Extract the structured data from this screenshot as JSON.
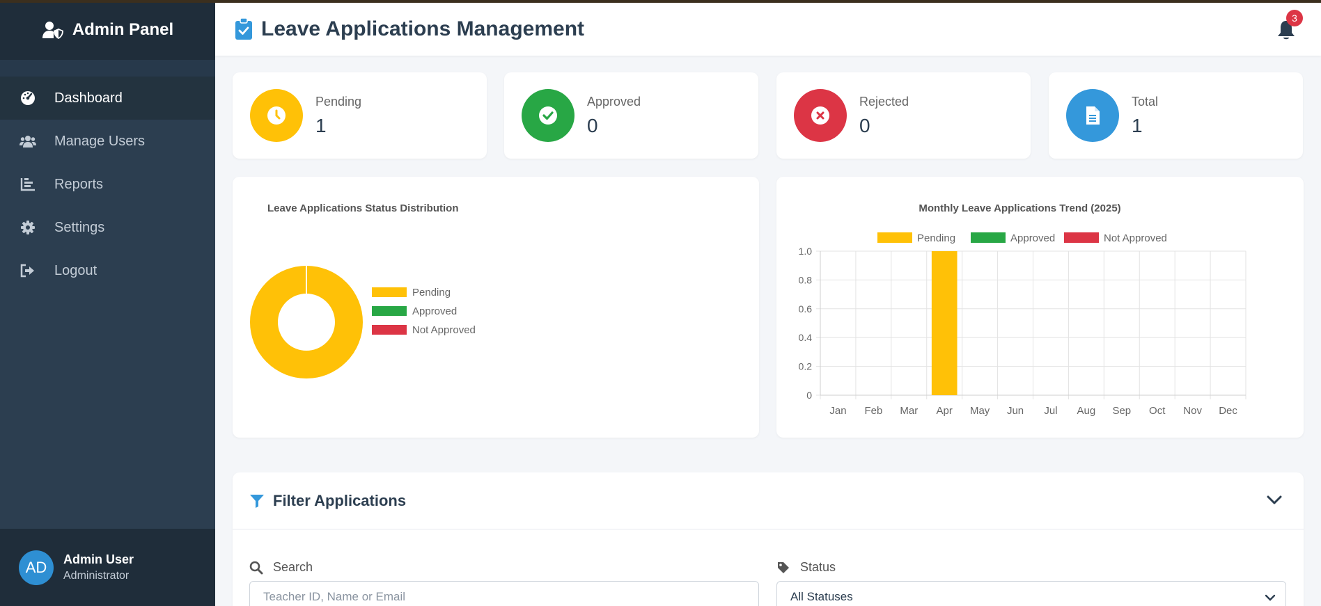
{
  "sidebar": {
    "brand": "Admin Panel",
    "items": [
      {
        "label": "Dashboard",
        "icon": "gauge-icon",
        "active": true
      },
      {
        "label": "Manage Users",
        "icon": "users-icon"
      },
      {
        "label": "Reports",
        "icon": "chart-bar-icon"
      },
      {
        "label": "Settings",
        "icon": "gear-icon"
      },
      {
        "label": "Logout",
        "icon": "logout-icon"
      }
    ],
    "user": {
      "initials": "AD",
      "name": "Admin User",
      "role": "Administrator"
    }
  },
  "header": {
    "title": "Leave Applications Management",
    "notifications": "3"
  },
  "stats": [
    {
      "label": "Pending",
      "value": "1",
      "color": "#ffc107",
      "icon": "clock-icon"
    },
    {
      "label": "Approved",
      "value": "0",
      "color": "#28a745",
      "icon": "check-icon"
    },
    {
      "label": "Rejected",
      "value": "0",
      "color": "#dc3545",
      "icon": "x-icon"
    },
    {
      "label": "Total",
      "value": "1",
      "color": "#3498db",
      "icon": "document-icon"
    }
  ],
  "chart_data": [
    {
      "type": "pie",
      "title": "Leave Applications Status Distribution",
      "categories": [
        "Pending",
        "Approved",
        "Not Approved"
      ],
      "values": [
        1,
        0,
        0
      ],
      "colors": [
        "#ffc107",
        "#28a745",
        "#dc3545"
      ],
      "legend": "right",
      "donut": true
    },
    {
      "type": "bar",
      "title": "Monthly Leave Applications Trend (2025)",
      "categories": [
        "Jan",
        "Feb",
        "Mar",
        "Apr",
        "May",
        "Jun",
        "Jul",
        "Aug",
        "Sep",
        "Oct",
        "Nov",
        "Dec"
      ],
      "series": [
        {
          "name": "Pending",
          "color": "#ffc107",
          "values": [
            0,
            0,
            0,
            1,
            0,
            0,
            0,
            0,
            0,
            0,
            0,
            0
          ]
        },
        {
          "name": "Approved",
          "color": "#28a745",
          "values": [
            0,
            0,
            0,
            0,
            0,
            0,
            0,
            0,
            0,
            0,
            0,
            0
          ]
        },
        {
          "name": "Not Approved",
          "color": "#dc3545",
          "values": [
            0,
            0,
            0,
            0,
            0,
            0,
            0,
            0,
            0,
            0,
            0,
            0
          ]
        }
      ],
      "ylim": [
        0,
        1.0
      ],
      "yticks": [
        "0",
        "0.2",
        "0.4",
        "0.6",
        "0.8",
        "1.0"
      ],
      "grid": true,
      "legend": "top",
      "stacked": true
    }
  ],
  "filter": {
    "title": "Filter Applications",
    "search_label": "Search",
    "search_placeholder": "Teacher ID, Name or Email",
    "status_label": "Status",
    "status_value": "All Statuses"
  }
}
